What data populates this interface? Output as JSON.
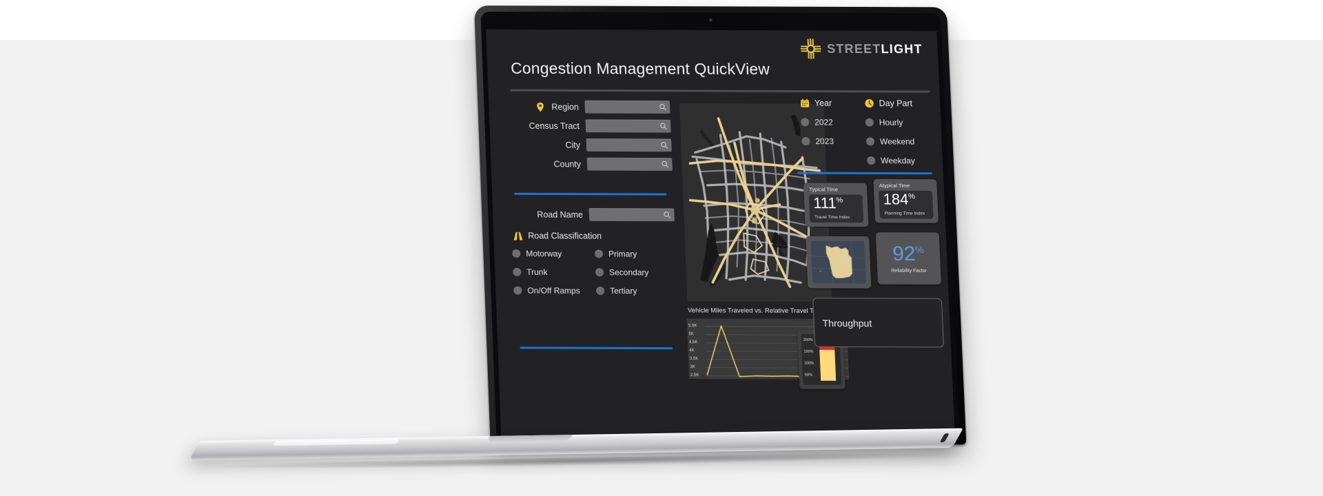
{
  "brand": {
    "logo_icon": "streetlight-sunburst-icon",
    "word_primary": "STREET",
    "word_secondary": "LIGHT"
  },
  "header": {
    "title": "Congestion Management QuickView"
  },
  "filters": {
    "geography": [
      {
        "label": "Region",
        "icon": "map-pin-icon",
        "value": "",
        "placeholder": ""
      },
      {
        "label": "Census Tract",
        "icon": "",
        "value": "",
        "placeholder": ""
      },
      {
        "label": "City",
        "icon": "",
        "value": "",
        "placeholder": ""
      },
      {
        "label": "County",
        "icon": "",
        "value": "",
        "placeholder": ""
      }
    ],
    "road_name": {
      "label": "Road Name",
      "value": "",
      "placeholder": ""
    },
    "road_classification": {
      "heading": "Road Classification",
      "icon": "road-icon",
      "options": [
        {
          "label": "Motorway",
          "selected": false
        },
        {
          "label": "Primary",
          "selected": false
        },
        {
          "label": "Trunk",
          "selected": false
        },
        {
          "label": "Secondary",
          "selected": false
        },
        {
          "label": "On/Off Ramps",
          "selected": false
        },
        {
          "label": "Tertiary",
          "selected": false
        }
      ]
    },
    "year": {
      "heading": "Year",
      "icon": "calendar-icon",
      "options": [
        {
          "label": "2022",
          "selected": false
        },
        {
          "label": "2023",
          "selected": false
        }
      ]
    },
    "day_part": {
      "heading": "Day Part",
      "icon": "clock-icon",
      "options": [
        {
          "label": "Hourly",
          "selected": false
        },
        {
          "label": "Weekend",
          "selected": false
        },
        {
          "label": "Weekday",
          "selected": false
        }
      ]
    }
  },
  "map": {
    "name": "road-network-map",
    "background": "#2f2f30",
    "road_color_base": "#b9b9be",
    "road_color_highlight": "#e9d08f"
  },
  "kpis": [
    {
      "name": "typical-time",
      "label": "Typical Time",
      "value": "111",
      "unit": "%",
      "sub": "Travel Time Index"
    },
    {
      "name": "atypical-time",
      "label": "Atypical Time",
      "value": "184",
      "unit": "%",
      "sub": "Planning Time Index"
    },
    {
      "name": "reliability-factor",
      "label": "",
      "value": "92",
      "unit": "%",
      "sub": "Reliability Factor",
      "color": "#5d9bdd"
    }
  ],
  "state_thumbnail": {
    "name": "minnesota-state-map",
    "shape_color": "#e2cf9b",
    "background": "#3c4654"
  },
  "throughput_card": {
    "label": "Throughput"
  },
  "chart_data": {
    "type": "line",
    "title": "Vehicle Miles Traveled vs. Relative Travel Time",
    "xlabel": "",
    "ylabel": "",
    "ylim": [
      2500,
      5500
    ],
    "yticks": [
      "5.5K",
      "5K",
      "4.5K",
      "4K",
      "3.5K",
      "3K",
      "2.5K"
    ],
    "ytick_values": [
      5500,
      5000,
      4500,
      4000,
      3500,
      3000,
      2500
    ],
    "grid": true,
    "line_color": "#e8c45f",
    "x": [
      0,
      1,
      2,
      3,
      4,
      5,
      6,
      7,
      8
    ],
    "series": [
      {
        "name": "Vehicle Miles Traveled",
        "values": [
          2500,
          5400,
          2450,
          2500,
          2480,
          2500,
          2470,
          2500,
          2490
        ]
      }
    ],
    "legend": {
      "name": "relative-travel-time-scale",
      "position": "inset-right",
      "ticks": [
        "200%",
        "150%",
        "100%",
        "50%"
      ],
      "tick_values": [
        200,
        150,
        100,
        50
      ],
      "colors": [
        "#e8242c",
        "#ffd97a"
      ],
      "stops": [
        {
          "from": 150,
          "to": 200,
          "color": "#e8242c"
        },
        {
          "from": 50,
          "to": 150,
          "color": "#ffd97a"
        }
      ]
    }
  },
  "cursor": {
    "name": "mouse-pointer",
    "over": "Census Tract"
  },
  "theme": {
    "app_background": "#222224",
    "page_background": "#f1f1f1",
    "accent_blue": "#1b74d4",
    "accent_gold": "#e8c45f",
    "input_background": "#6f6f72"
  }
}
